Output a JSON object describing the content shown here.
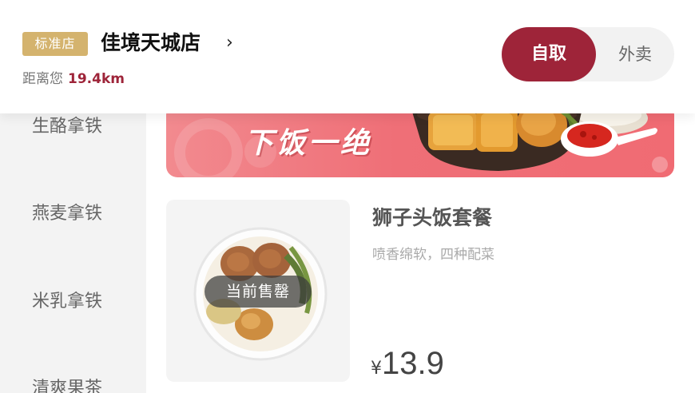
{
  "store": {
    "badge": "标准店",
    "name": "佳境天城店",
    "chevron": "›",
    "distance_label": "距离您",
    "distance_value": "19.4km"
  },
  "mode_toggle": {
    "pickup": "自取",
    "delivery": "外卖",
    "active": "pickup",
    "accent_color": "#9e2439"
  },
  "sidebar": {
    "items": [
      {
        "label": "生酪拿铁"
      },
      {
        "label": "燕麦拿铁"
      },
      {
        "label": "米乳拿铁"
      },
      {
        "label": "清爽果茶"
      }
    ]
  },
  "banner": {
    "text": "下饭一绝"
  },
  "product": {
    "name": "狮子头饭套餐",
    "description": "喷香绵软，四种配菜",
    "status": "当前售罄",
    "currency": "¥",
    "price": "13.9"
  }
}
